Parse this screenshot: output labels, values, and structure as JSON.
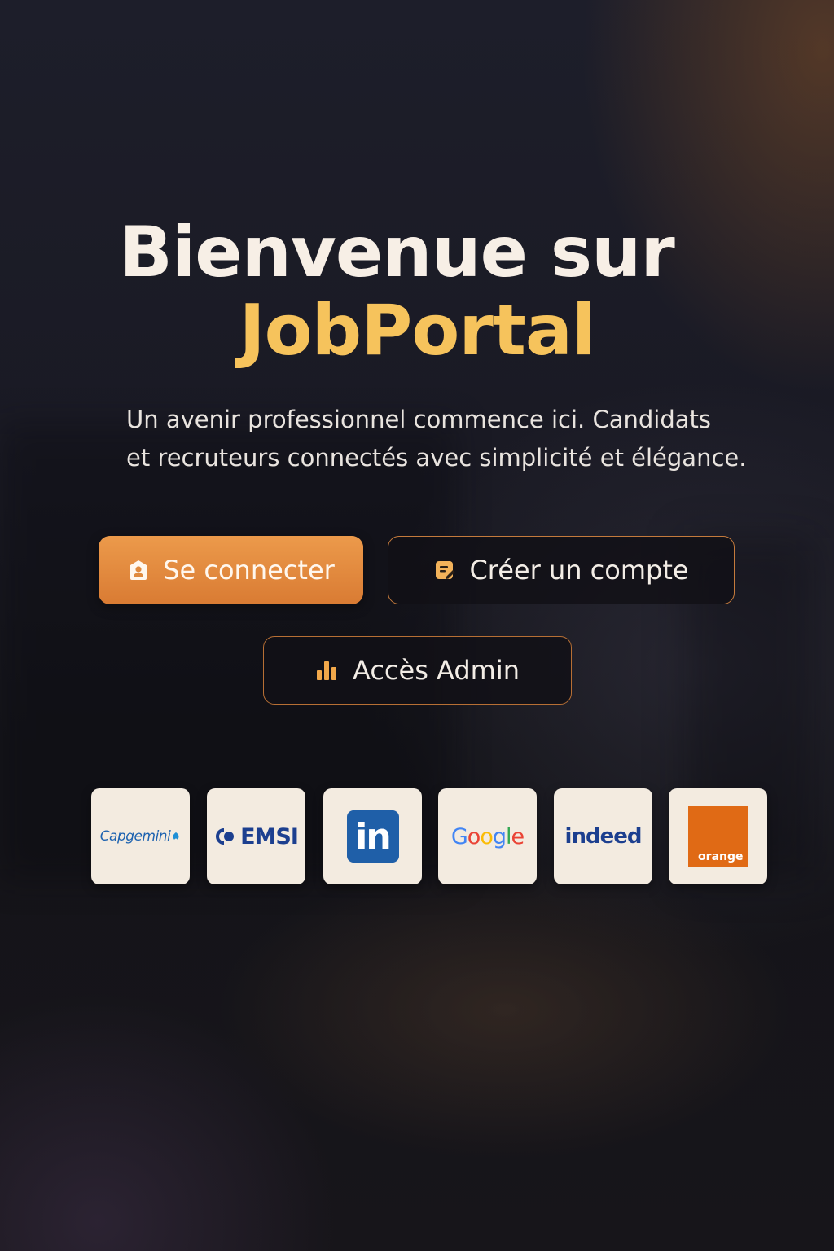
{
  "hero": {
    "title_line1": "Bienvenue sur",
    "title_line2": "JobPortal",
    "subtitle_line1": "Un avenir professionnel commence ici. Candidats",
    "subtitle_line2": "et recruteurs connectés avec simplicité et élégance."
  },
  "actions": {
    "login_label": "Se connecter",
    "login_icon": "user-lock-icon",
    "create_label": "Créer un compte",
    "create_icon": "edit-note-icon",
    "admin_label": "Accès Admin",
    "admin_icon": "bar-chart-icon"
  },
  "partners": [
    {
      "name": "Capgemini",
      "label": "Capgemini"
    },
    {
      "name": "EMSI",
      "label": "EMSI"
    },
    {
      "name": "LinkedIn",
      "label": "in"
    },
    {
      "name": "Google",
      "label": "Google"
    },
    {
      "name": "Indeed",
      "label": "indeed"
    },
    {
      "name": "Orange",
      "label": "orange"
    }
  ],
  "colors": {
    "accent": "#f6c35c",
    "primary_button": "#e48b3e",
    "background": "#17161d"
  }
}
